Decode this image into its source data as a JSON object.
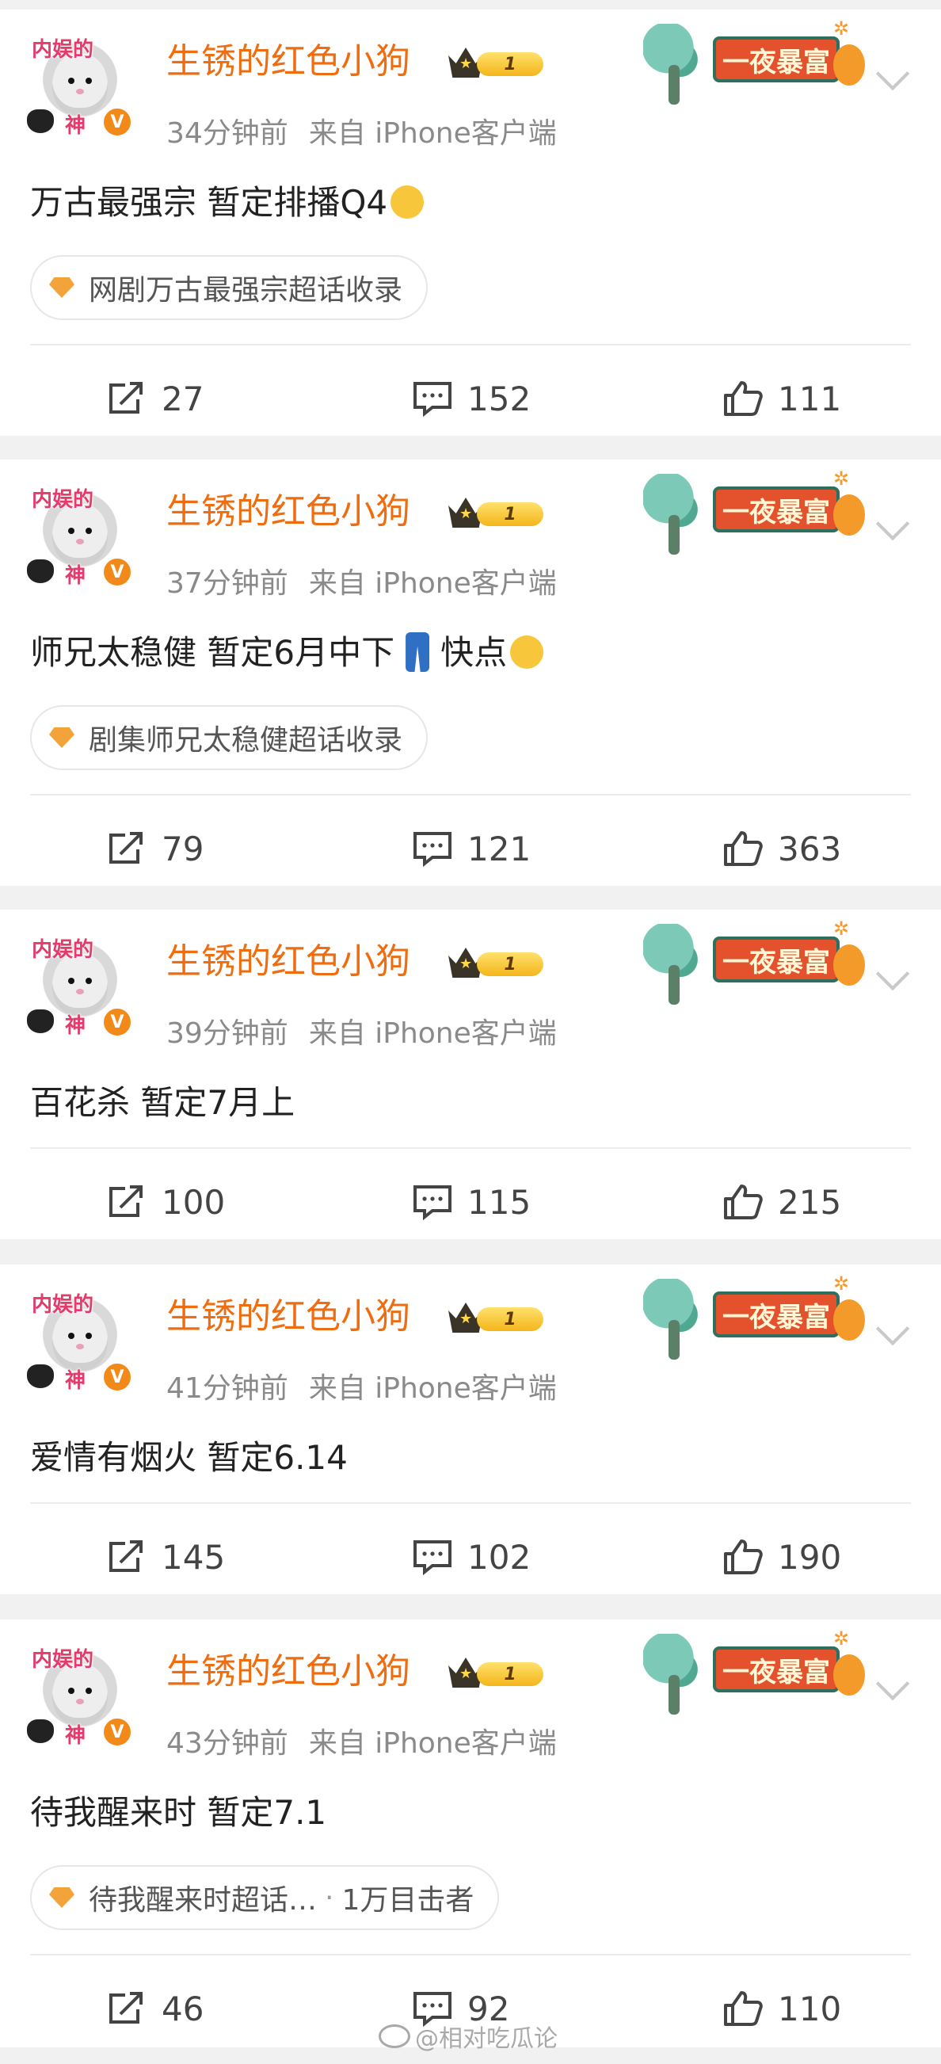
{
  "posts": [
    {
      "username": "生锈的红色小狗",
      "vip_level": "1",
      "time": "34分钟前",
      "source": "来自 iPhone客户端",
      "text": "万古最强宗 暂定排播Q4",
      "emoji_after": "crying-face",
      "tag": "网剧万古最强宗超话收录",
      "tag_suffix": "",
      "shares": "27",
      "comments": "152",
      "likes": "111"
    },
    {
      "username": "生锈的红色小狗",
      "vip_level": "1",
      "time": "37分钟前",
      "source": "来自 iPhone客户端",
      "text": "师兄太稳健 暂定6月中下",
      "text_after_emoji": "快点",
      "emoji_mid": "jeans",
      "emoji_after": "tired-face",
      "tag": "剧集师兄太稳健超话收录",
      "tag_suffix": "",
      "shares": "79",
      "comments": "121",
      "likes": "363"
    },
    {
      "username": "生锈的红色小狗",
      "vip_level": "1",
      "time": "39分钟前",
      "source": "来自 iPhone客户端",
      "text": "百花杀 暂定7月上",
      "tag": "",
      "shares": "100",
      "comments": "115",
      "likes": "215"
    },
    {
      "username": "生锈的红色小狗",
      "vip_level": "1",
      "time": "41分钟前",
      "source": "来自 iPhone客户端",
      "text": "爱情有烟火 暂定6.14",
      "tag": "",
      "shares": "145",
      "comments": "102",
      "likes": "190"
    },
    {
      "username": "生锈的红色小狗",
      "vip_level": "1",
      "time": "43分钟前",
      "source": "来自 iPhone客户端",
      "text": "待我醒来时 暂定7.1",
      "tag": "待我醒来时超话…",
      "tag_dot": "·",
      "tag_suffix": "1万目击者",
      "shares": "46",
      "comments": "92",
      "likes": "110"
    }
  ],
  "avatar_stickers": {
    "top": "内娱的",
    "bottom": "神",
    "verified": "V"
  },
  "decoration_banner": "一夜暴富",
  "watermark": "@相对吃瓜论",
  "colors": {
    "username": "#ee6d10",
    "background": "#f1f1f1",
    "banner": "#e4522d"
  }
}
